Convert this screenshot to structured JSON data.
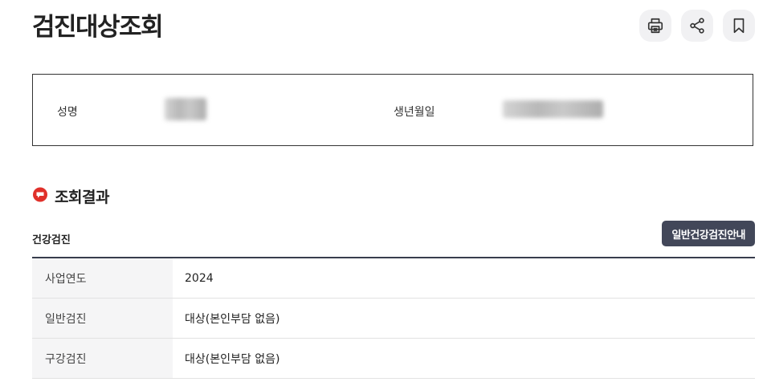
{
  "page": {
    "title": "검진대상조회"
  },
  "toolbar": {
    "icons": [
      "print-icon",
      "share-icon",
      "bookmark-icon"
    ]
  },
  "info": {
    "name_label": "성명",
    "birth_label": "생년월일"
  },
  "result": {
    "heading": "조회결과",
    "icon": "speech-bubble-icon",
    "accent_color": "#e0302a"
  },
  "checkup": {
    "title": "건강검진",
    "guide_button": "일반건강검진안내",
    "rows": [
      {
        "label": "사업연도",
        "value": "2024"
      },
      {
        "label": "일반검진",
        "value": "대상(본인부담 없음)"
      },
      {
        "label": "구강검진",
        "value": "대상(본인부담 없음)"
      }
    ]
  }
}
